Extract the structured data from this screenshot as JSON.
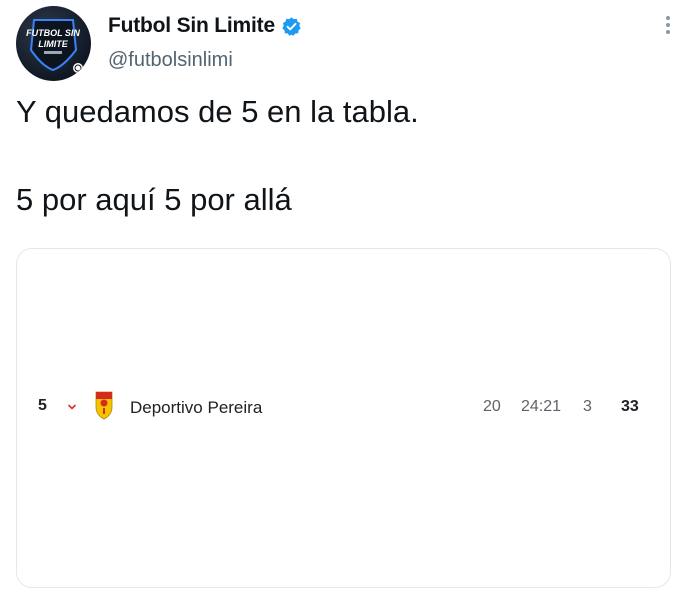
{
  "account": {
    "display_name": "Futbol Sin Limite",
    "handle": "@futbolsinlimi",
    "avatar_text_line1": "FUTBOL SIN",
    "avatar_text_line2": "LIMITE",
    "verified": true
  },
  "tweet": {
    "line1": "Y quedamos de 5 en la tabla.",
    "line2": "5 por aquí 5 por allá"
  },
  "standings_row": {
    "position": "5",
    "trend": "down",
    "team": "Deportivo Pereira",
    "played": "20",
    "goals": "24:21",
    "goal_difference": "3",
    "points": "33"
  },
  "icons": {
    "more": "more-vertical-icon",
    "verified": "verified-badge-icon",
    "trend": "chevron-down-icon",
    "crest": "team-crest-icon"
  },
  "colors": {
    "verified_blue": "#1d9bf0",
    "trend_red": "#d93025",
    "crest_yellow": "#f5c400",
    "crest_red": "#d62a1e"
  }
}
